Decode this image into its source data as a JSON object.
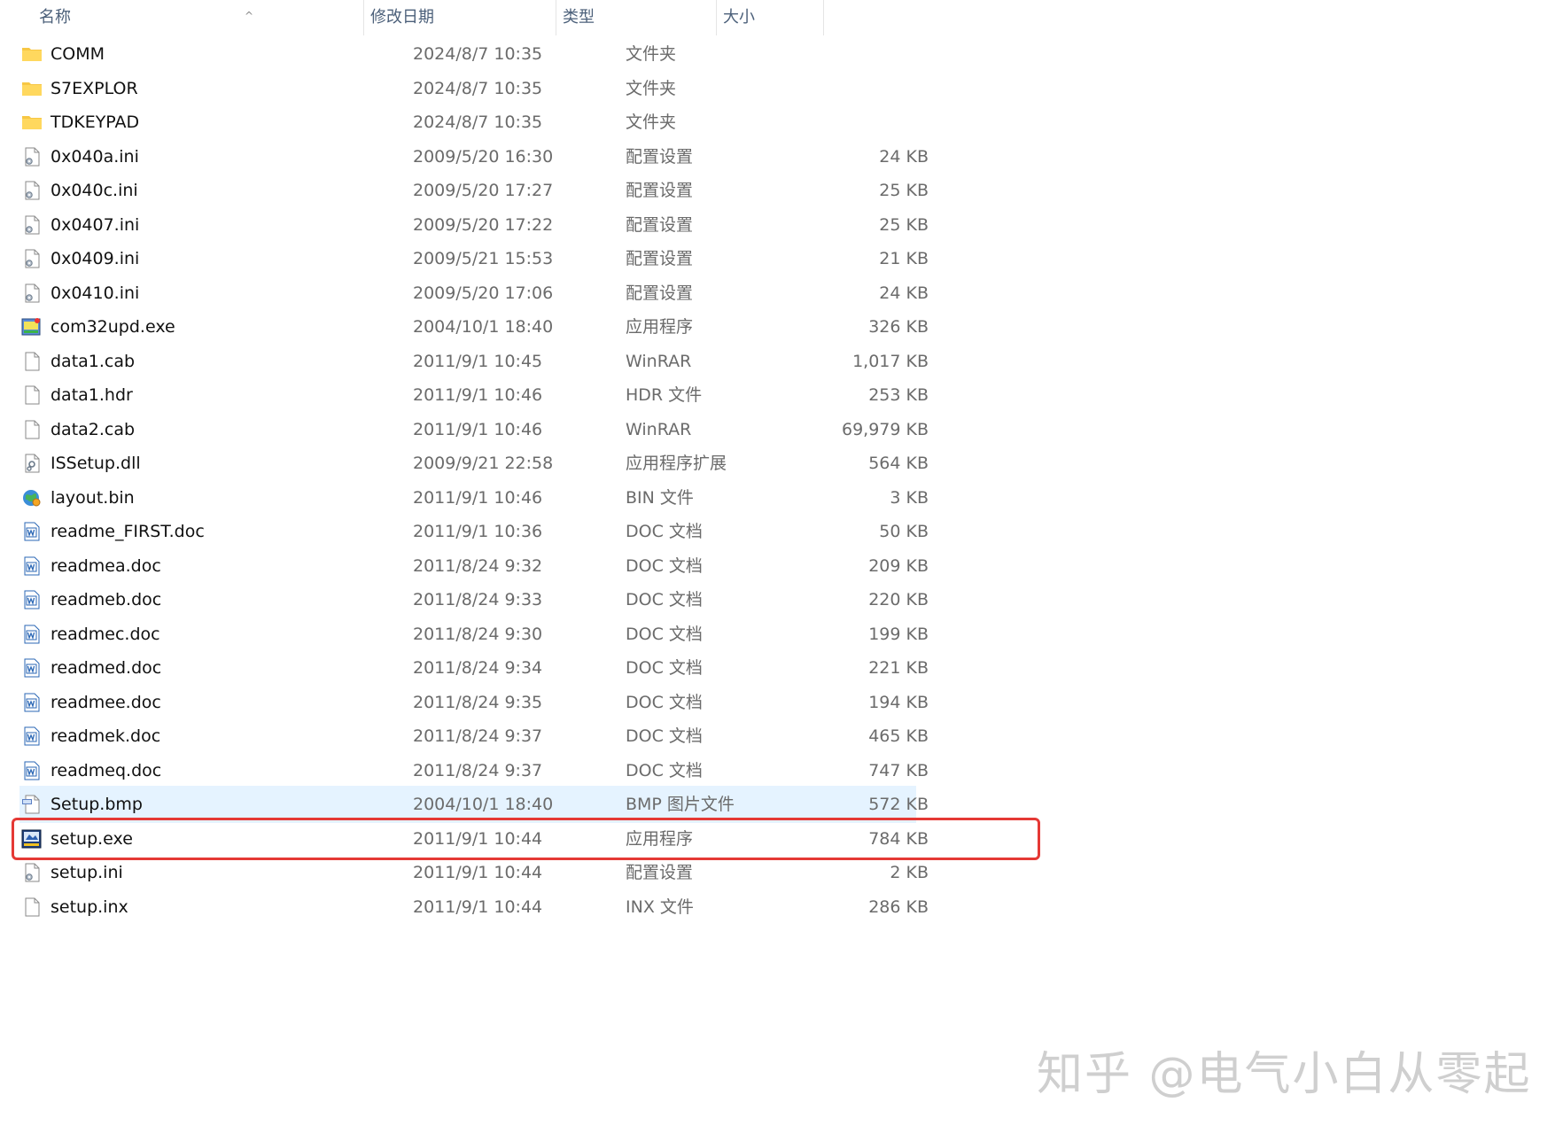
{
  "columns": {
    "name": "名称",
    "modified": "修改日期",
    "type": "类型",
    "size": "大小"
  },
  "files": [
    {
      "name": "COMM",
      "modified": "2024/8/7 10:35",
      "type": "文件夹",
      "size": "",
      "icon": "folder-icon"
    },
    {
      "name": "S7EXPLOR",
      "modified": "2024/8/7 10:35",
      "type": "文件夹",
      "size": "",
      "icon": "folder-icon"
    },
    {
      "name": "TDKEYPAD",
      "modified": "2024/8/7 10:35",
      "type": "文件夹",
      "size": "",
      "icon": "folder-icon"
    },
    {
      "name": "0x040a.ini",
      "modified": "2009/5/20 16:30",
      "type": "配置设置",
      "size": "24 KB",
      "icon": "ini-file-icon"
    },
    {
      "name": "0x040c.ini",
      "modified": "2009/5/20 17:27",
      "type": "配置设置",
      "size": "25 KB",
      "icon": "ini-file-icon"
    },
    {
      "name": "0x0407.ini",
      "modified": "2009/5/20 17:22",
      "type": "配置设置",
      "size": "25 KB",
      "icon": "ini-file-icon"
    },
    {
      "name": "0x0409.ini",
      "modified": "2009/5/21 15:53",
      "type": "配置设置",
      "size": "21 KB",
      "icon": "ini-file-icon"
    },
    {
      "name": "0x0410.ini",
      "modified": "2009/5/20 17:06",
      "type": "配置设置",
      "size": "24 KB",
      "icon": "ini-file-icon"
    },
    {
      "name": "com32upd.exe",
      "modified": "2004/10/1 18:40",
      "type": "应用程序",
      "size": "326 KB",
      "icon": "installer-exe-icon"
    },
    {
      "name": "data1.cab",
      "modified": "2011/9/1 10:45",
      "type": "WinRAR",
      "size": "1,017 KB",
      "icon": "blank-file-icon"
    },
    {
      "name": "data1.hdr",
      "modified": "2011/9/1 10:46",
      "type": "HDR 文件",
      "size": "253 KB",
      "icon": "blank-file-icon"
    },
    {
      "name": "data2.cab",
      "modified": "2011/9/1 10:46",
      "type": "WinRAR",
      "size": "69,979 KB",
      "icon": "blank-file-icon"
    },
    {
      "name": "ISSetup.dll",
      "modified": "2009/9/21 22:58",
      "type": "应用程序扩展",
      "size": "564 KB",
      "icon": "dll-file-icon"
    },
    {
      "name": "layout.bin",
      "modified": "2011/9/1 10:46",
      "type": "BIN 文件",
      "size": "3 KB",
      "icon": "globe-icon"
    },
    {
      "name": "readme_FIRST.doc",
      "modified": "2011/9/1 10:36",
      "type": "DOC 文档",
      "size": "50 KB",
      "icon": "doc-file-icon"
    },
    {
      "name": "readmea.doc",
      "modified": "2011/8/24 9:32",
      "type": "DOC 文档",
      "size": "209 KB",
      "icon": "doc-file-icon"
    },
    {
      "name": "readmeb.doc",
      "modified": "2011/8/24 9:33",
      "type": "DOC 文档",
      "size": "220 KB",
      "icon": "doc-file-icon"
    },
    {
      "name": "readmec.doc",
      "modified": "2011/8/24 9:30",
      "type": "DOC 文档",
      "size": "199 KB",
      "icon": "doc-file-icon"
    },
    {
      "name": "readmed.doc",
      "modified": "2011/8/24 9:34",
      "type": "DOC 文档",
      "size": "221 KB",
      "icon": "doc-file-icon"
    },
    {
      "name": "readmee.doc",
      "modified": "2011/8/24 9:35",
      "type": "DOC 文档",
      "size": "194 KB",
      "icon": "doc-file-icon"
    },
    {
      "name": "readmek.doc",
      "modified": "2011/8/24 9:37",
      "type": "DOC 文档",
      "size": "465 KB",
      "icon": "doc-file-icon"
    },
    {
      "name": "readmeq.doc",
      "modified": "2011/8/24 9:37",
      "type": "DOC 文档",
      "size": "747 KB",
      "icon": "doc-file-icon"
    },
    {
      "name": "Setup.bmp",
      "modified": "2004/10/1 18:40",
      "type": "BMP 图片文件",
      "size": "572 KB",
      "icon": "bmp-file-icon",
      "hovered": true
    },
    {
      "name": "setup.exe",
      "modified": "2011/9/1 10:44",
      "type": "应用程序",
      "size": "784 KB",
      "icon": "setup-exe-icon",
      "highlighted": true
    },
    {
      "name": "setup.ini",
      "modified": "2011/9/1 10:44",
      "type": "配置设置",
      "size": "2 KB",
      "icon": "ini-file-icon"
    },
    {
      "name": "setup.inx",
      "modified": "2011/9/1 10:44",
      "type": "INX 文件",
      "size": "286 KB",
      "icon": "blank-file-icon"
    }
  ],
  "colors": {
    "highlight_outline": "#e53935",
    "hover_bg": "#e5f3ff",
    "folder": "#f7c744"
  },
  "watermark": "知乎 @电气小白从零起"
}
